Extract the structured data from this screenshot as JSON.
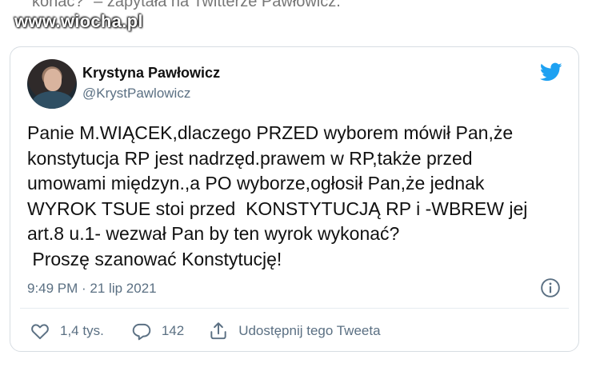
{
  "header": {
    "caption_text": "konać?\" – zapytała na Twitterze Pawłowicz.",
    "watermark": "www.wiocha.pl"
  },
  "tweet": {
    "author_name": "Krystyna Pawłowicz",
    "author_handle": "@KrystPawlowicz",
    "text": "Panie M.WIĄCEK,dlaczego PRZED wyborem mówił Pan,że\nkonstytucja RP jest nadrzęd.prawem w RP,także przed\numowami międzyn.,a PO wyborze,ogłosił Pan,że jednak\nWYROK TSUE stoi przed  KONSTYTUCJĄ RP i -WBREW jej\nart.8 u.1- wezwał Pan by ten wyrok wykonać?\n Proszę szanować Konstytucję!",
    "timestamp": "9:49 PM · 21 lip 2021"
  },
  "actions": {
    "likes": "1,4 tys.",
    "replies": "142",
    "share_label": "Udostępnij tego Tweeta"
  },
  "colors": {
    "twitter_blue": "#1da1f2",
    "secondary_text": "#5b7083",
    "border": "#d7dde2"
  },
  "icons": [
    "twitter-bird-icon",
    "info-icon",
    "heart-icon",
    "reply-icon",
    "share-icon"
  ]
}
